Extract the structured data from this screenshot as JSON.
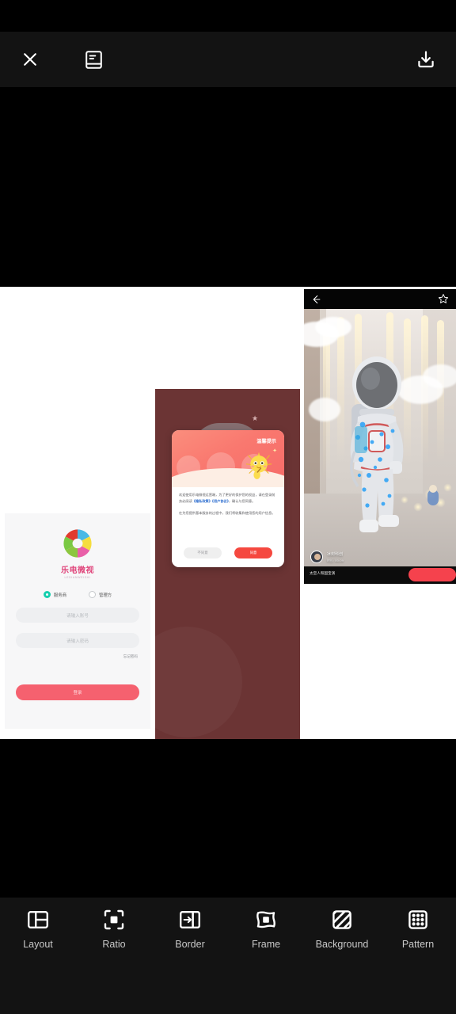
{
  "app": {
    "background_color": "#131313",
    "canvas_color": "#ffffff",
    "accent_color": "#f5616f"
  },
  "topbar": {
    "close_icon": "close-icon",
    "template_icon": "book-template-icon",
    "save_icon": "download-save-icon"
  },
  "canvas": {
    "cells": [
      {
        "name": "login-screenshot",
        "logo_cn": "乐电微视",
        "logo_en": "LEDIANWEISHI",
        "radios": [
          {
            "label": "服务商",
            "selected": true
          },
          {
            "label": "管理方",
            "selected": false
          }
        ],
        "account_placeholder": "请输入账号",
        "password_placeholder": "请输入密码",
        "forgot_label": "忘记密码",
        "login_label": "登录"
      },
      {
        "name": "privacy-dialog-screenshot",
        "background_color": "#6b3434",
        "dialog_title": "温馨提示",
        "paragraph_1_pre": "欢迎使用乐电微视运营端，为了更好的保护您的权益，请在登录前务必阅读",
        "link_1": "《隐私政策》",
        "link_2": "《用户协议》",
        "paragraph_1_post": "，确认与您同意。",
        "paragraph_2": "在为您提供基本服务的过程中，我们将收集和使用您的用户信息。",
        "disagree_label": "不同意",
        "agree_label": "同意"
      },
      {
        "name": "astronaut-video-screenshot",
        "back_icon": "back-arrow-icon",
        "favorite_icon": "star-icon",
        "username": "冰封科创",
        "duration": "时长: 00:09",
        "caption": "太空人和国宝演",
        "cta_color": "#f5424d"
      }
    ]
  },
  "bottombar": {
    "tools": [
      {
        "label": "Layout",
        "icon": "layout-icon"
      },
      {
        "label": "Ratio",
        "icon": "ratio-crop-icon"
      },
      {
        "label": "Border",
        "icon": "border-icon"
      },
      {
        "label": "Frame",
        "icon": "frame-icon"
      },
      {
        "label": "Background",
        "icon": "background-hatch-icon"
      },
      {
        "label": "Pattern",
        "icon": "pattern-grid-icon"
      }
    ]
  }
}
